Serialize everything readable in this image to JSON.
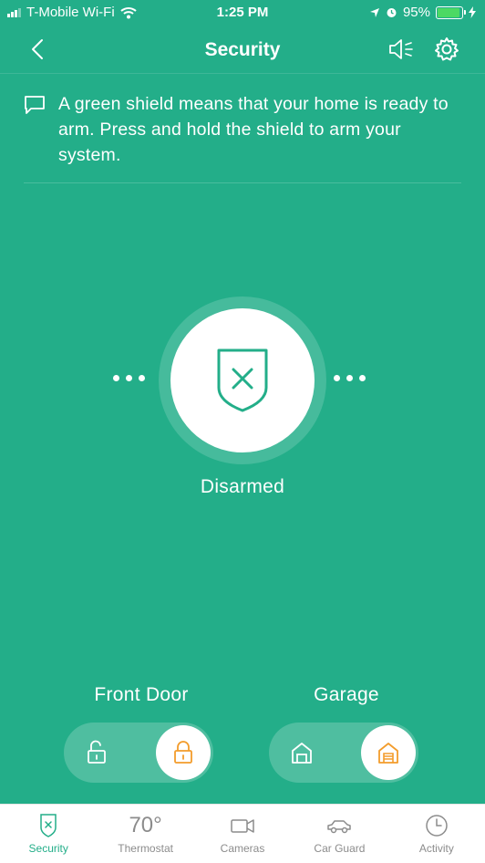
{
  "status_bar": {
    "carrier": "T-Mobile Wi-Fi",
    "time": "1:25 PM",
    "battery_percent": "95%",
    "battery_level": 0.95
  },
  "nav": {
    "title": "Security",
    "icons": [
      "back-chevron-icon",
      "speaker-icon",
      "gear-icon"
    ]
  },
  "message": {
    "text": "A green shield means that your home is ready to arm. Press and hold the shield to arm your system."
  },
  "security": {
    "status": "Disarmed",
    "icon": "shield-x-icon"
  },
  "devices": [
    {
      "name": "Front Door",
      "state": "locked",
      "icons": [
        "unlocked-padlock-icon",
        "locked-padlock-icon"
      ]
    },
    {
      "name": "Garage",
      "state": "closed",
      "icons": [
        "garage-open-icon",
        "garage-closed-icon"
      ]
    }
  ],
  "tabs": [
    {
      "label": "Security",
      "active": true,
      "icon": "shield-x-icon"
    },
    {
      "label": "Thermostat",
      "active": false,
      "value": "70°"
    },
    {
      "label": "Cameras",
      "active": false,
      "icon": "video-camera-icon"
    },
    {
      "label": "Car Guard",
      "active": false,
      "icon": "car-icon"
    },
    {
      "label": "Activity",
      "active": false,
      "icon": "clock-icon"
    }
  ],
  "colors": {
    "background": "#23ae89",
    "accent_orange": "#f39c2b",
    "tab_inactive": "#8c8c8c",
    "battery_green": "#4cd964"
  }
}
